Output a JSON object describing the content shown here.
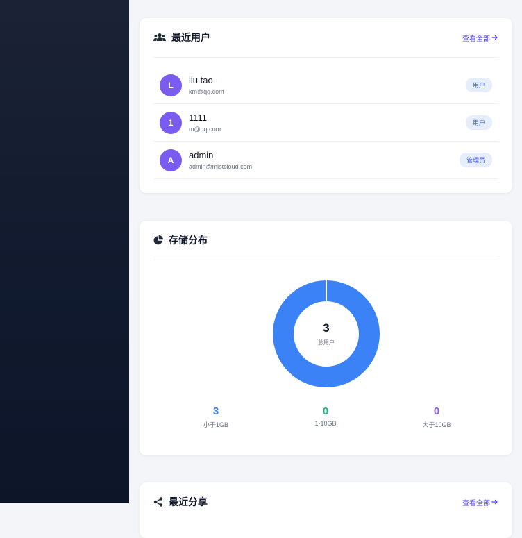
{
  "recent_users": {
    "title": "最近用户",
    "view_all": "查看全部",
    "users": [
      {
        "initial": "L",
        "name": "liu tao",
        "email": "km@qq.com",
        "role": "用户"
      },
      {
        "initial": "1",
        "name": "1111",
        "email": "m@qq.com",
        "role": "用户"
      },
      {
        "initial": "A",
        "name": "admin",
        "email": "admin@mistcloud.com",
        "role": "管理员"
      }
    ]
  },
  "storage_distribution": {
    "title": "存储分布",
    "center_value": "3",
    "center_label": "总用户",
    "stats": [
      {
        "value": "3",
        "label": "小于1GB",
        "color": "#3b82f6"
      },
      {
        "value": "0",
        "label": "1-10GB",
        "color": "#10b981"
      },
      {
        "value": "0",
        "label": "大于10GB",
        "color": "#8b5cf6"
      }
    ],
    "donut_color": "#3b82f6"
  },
  "recent_shares": {
    "title": "最近分享",
    "view_all": "查看全部"
  },
  "chart_data": {
    "type": "pie",
    "categories": [
      "小于1GB",
      "1-10GB",
      "大于10GB"
    ],
    "values": [
      3,
      0,
      0
    ],
    "colors": [
      "#3b82f6",
      "#10b981",
      "#8b5cf6"
    ]
  }
}
